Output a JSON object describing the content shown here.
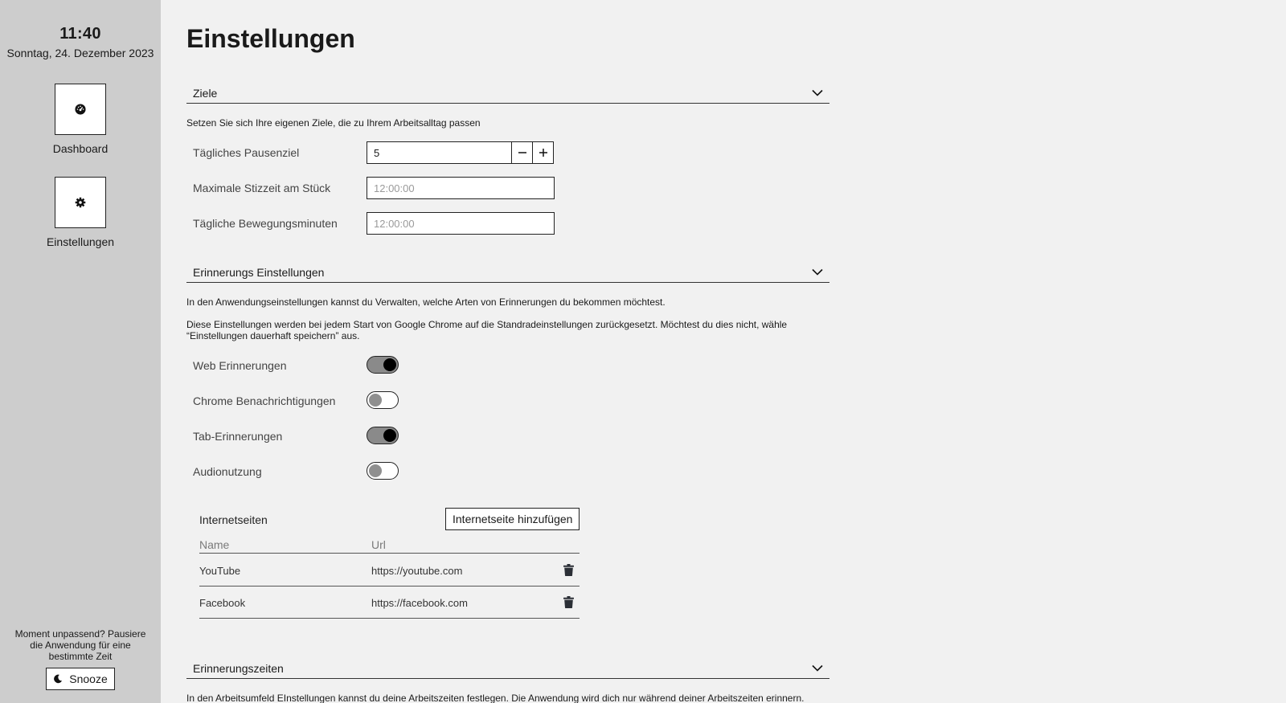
{
  "sidebar": {
    "time": "11:40",
    "date": "Sonntag, 24. Dezember 2023",
    "nav": [
      {
        "label": "Dashboard",
        "icon": "dashboard-gauge-icon"
      },
      {
        "label": "Einstellungen",
        "icon": "gear-icon"
      }
    ],
    "snooze_text": "Moment unpassend? Pausiere die Anwendung für eine bestimmte Zeit",
    "snooze_label": "Snooze"
  },
  "page": {
    "title": "Einstellungen"
  },
  "goals": {
    "header": "Ziele",
    "description": "Setzen Sie sich Ihre eigenen Ziele, die zu Ihrem Arbeitsalltag passen",
    "daily_break_label": "Tägliches Pausenziel",
    "daily_break_value": "5",
    "max_sitting_label": "Maximale Stizzeit am Stück",
    "max_sitting_placeholder": "12:00:00",
    "daily_movement_label": "Tägliche Bewegungsminuten",
    "daily_movement_placeholder": "12:00:00"
  },
  "reminders": {
    "header": "Erinnerungs Einstellungen",
    "description1": "In den Anwendungseinstellungen kannst du Verwalten, welche Arten von Erinnerungen du bekommen möchtest.",
    "description2": "Diese Einstellungen werden bei jedem Start von Google Chrome auf die Standradeinstellungen zurückgesetzt. Möchtest du dies nicht, wähle “Einstellungen dauerhaft speichern” aus.",
    "toggles": [
      {
        "label": "Web Erinnerungen",
        "on": true
      },
      {
        "label": "Chrome Benachrichtigungen",
        "on": false
      },
      {
        "label": "Tab-Erinnerungen",
        "on": true
      },
      {
        "label": "Audionutzung",
        "on": false
      }
    ],
    "sites": {
      "title": "Internetseiten",
      "add_label": "Internetseite hinzufügen",
      "col_name": "Name",
      "col_url": "Url",
      "rows": [
        {
          "name": "YouTube",
          "url": "https://youtube.com"
        },
        {
          "name": "Facebook",
          "url": "https://facebook.com"
        }
      ]
    }
  },
  "times": {
    "header": "Erinnerungszeiten",
    "description": "In den Arbeitsumfeld EInstellungen kannst du deine Arbeitszeiten festlegen. Die Anwendung wird dich nur während deiner Arbeitszeiten erinnern."
  }
}
